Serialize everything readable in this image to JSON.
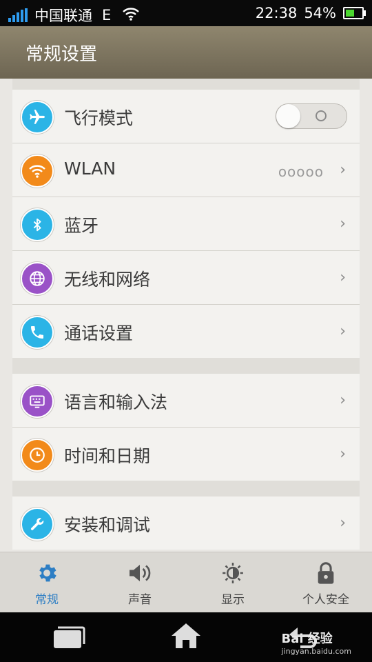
{
  "status_bar": {
    "carrier": "中国联通",
    "network": "E",
    "time": "22:38",
    "battery_percent": "54%",
    "battery_level": 0.54
  },
  "header": {
    "title": "常规设置"
  },
  "settings": [
    {
      "icon": "airplane-icon",
      "label": "飞行模式",
      "color": "#2bb4e6",
      "control": "toggle",
      "toggle_on": false
    },
    {
      "icon": "wifi-icon",
      "label": "WLAN",
      "color": "#f28a1a",
      "value": "ooooo"
    },
    {
      "icon": "bluetooth-icon",
      "label": "蓝牙",
      "color": "#2bb4e6"
    },
    {
      "icon": "globe-icon",
      "label": "无线和网络",
      "color": "#9a52c7"
    },
    {
      "icon": "phone-icon",
      "label": "通话设置",
      "color": "#2bb4e6"
    },
    {
      "icon": "keyboard-icon",
      "label": "语言和输入法",
      "color": "#9a52c7"
    },
    {
      "icon": "clock-icon",
      "label": "时间和日期",
      "color": "#f28a1a"
    },
    {
      "icon": "wrench-icon",
      "label": "安装和调试",
      "color": "#2bb4e6"
    }
  ],
  "tabs": [
    {
      "label": "常规",
      "icon": "gear-icon",
      "active": true
    },
    {
      "label": "声音",
      "icon": "speaker-icon",
      "active": false
    },
    {
      "label": "显示",
      "icon": "brightness-icon",
      "active": false
    },
    {
      "label": "个人安全",
      "icon": "lock-icon",
      "active": false
    }
  ],
  "nav": {
    "buttons": [
      "recent-apps-icon",
      "home-icon",
      "back-icon"
    ],
    "watermark": "Bai 经验",
    "watermark_url": "jingyan.baidu.com"
  },
  "colors": {
    "accent": "#2d7ec4",
    "header": "#7d7560"
  }
}
